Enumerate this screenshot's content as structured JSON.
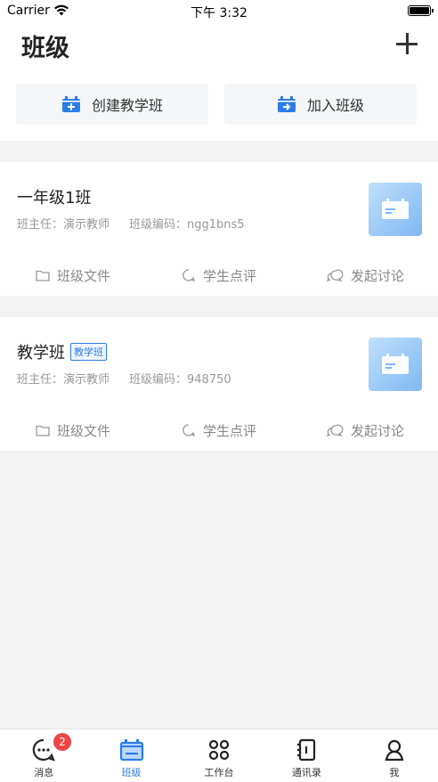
{
  "status": {
    "carrier": "Carrier",
    "time": "下午 3:32"
  },
  "header": {
    "title": "班级",
    "create_label": "创建教学班",
    "join_label": "加入班级"
  },
  "classes": [
    {
      "name": "一年级1班",
      "tag": "",
      "teacher": "班主任：演示教师",
      "code": "班级编码：ngg1bns5",
      "actions": [
        "班级文件",
        "学生点评",
        "发起讨论"
      ]
    },
    {
      "name": "教学班",
      "tag": "教学班",
      "teacher": "班主任：演示教师",
      "code": "班级编码：948750",
      "actions": [
        "班级文件",
        "学生点评",
        "发起讨论"
      ]
    }
  ],
  "tabbar": {
    "items": [
      {
        "label": "消息",
        "icon": "message-icon",
        "badge": "2"
      },
      {
        "label": "班级",
        "icon": "class-icon",
        "badge": ""
      },
      {
        "label": "工作台",
        "icon": "grid-icon",
        "badge": ""
      },
      {
        "label": "通讯录",
        "icon": "contacts-icon",
        "badge": ""
      },
      {
        "label": "我",
        "icon": "person-icon",
        "badge": ""
      }
    ],
    "active_index": 1
  },
  "colors": {
    "accent": "#2b7de9",
    "badge": "#f04444",
    "muted": "#999999"
  }
}
